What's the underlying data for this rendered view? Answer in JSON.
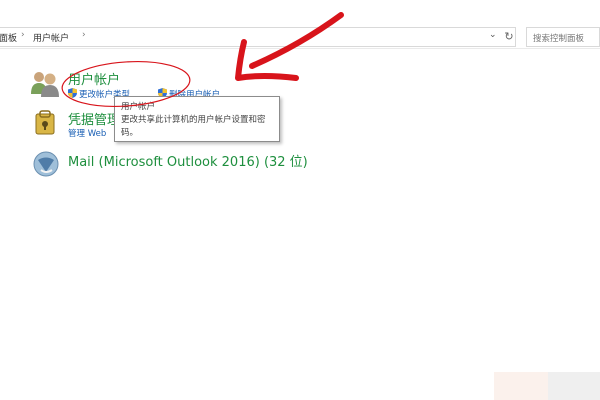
{
  "address_bar": {
    "crumbs": [
      "面板",
      "用户帐户"
    ],
    "search_placeholder": "搜索控制面板"
  },
  "items": [
    {
      "title": "用户帐户",
      "icon": "users-icon",
      "tasks": [
        {
          "label": "更改帐户类型",
          "icon": "uac-shield-icon"
        },
        {
          "label": "删除用户帐户",
          "icon": "uac-shield-icon"
        }
      ]
    },
    {
      "title": "凭据管理",
      "icon": "credential-manager-icon",
      "tasks": [
        {
          "label": "管理 Web"
        }
      ]
    },
    {
      "title": "Mail (Microsoft Outlook 2016) (32 位)",
      "icon": "mail-icon"
    }
  ],
  "tooltip": {
    "title": "用户帐户",
    "body": "更改共享此计算机的用户帐户设置和密码。"
  },
  "colors": {
    "link_green": "#1e8f3e",
    "link_blue": "#1a5fb4",
    "annotation_red": "#d8141b"
  }
}
